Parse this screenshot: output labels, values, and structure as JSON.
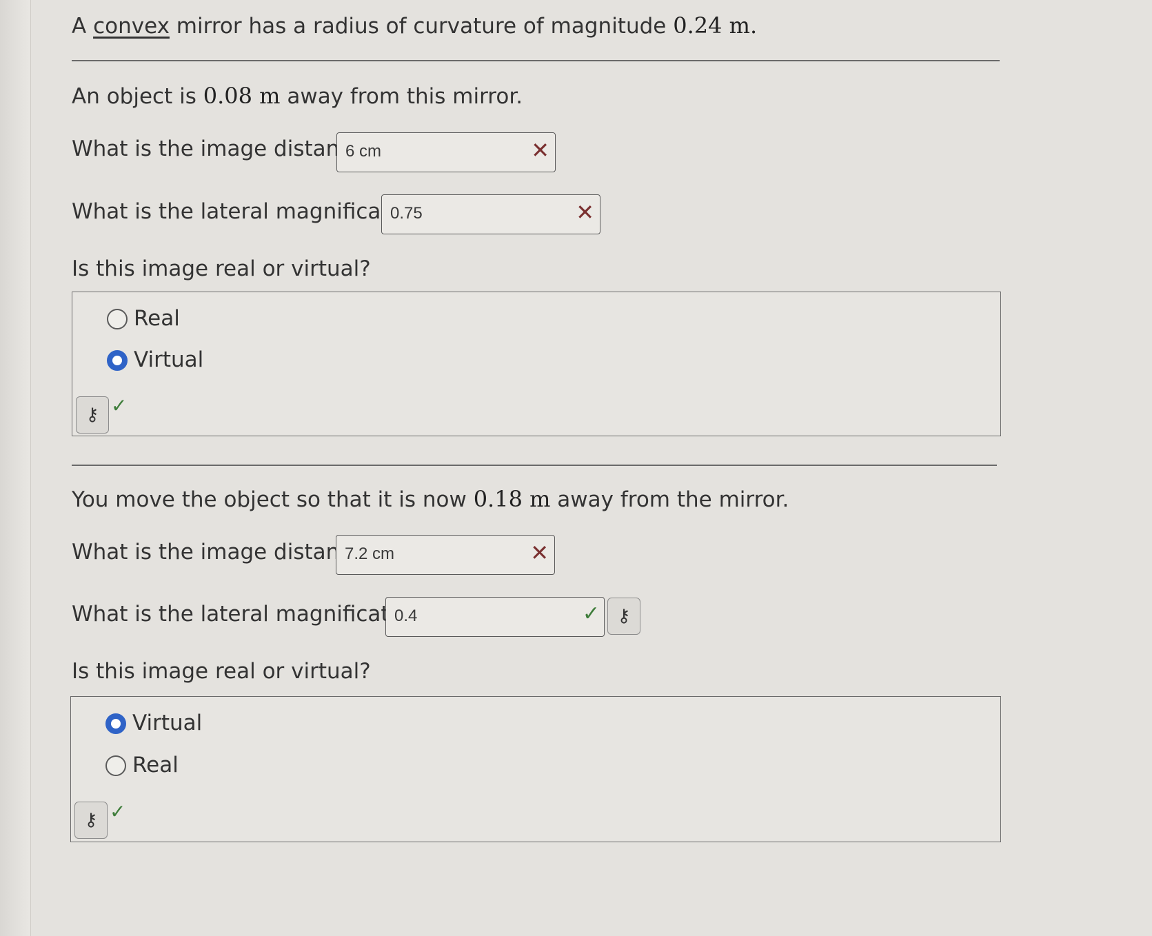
{
  "problem": {
    "intro_prefix": "A ",
    "intro_underlined": "convex",
    "intro_suffix": " mirror has a radius of curvature of magnitude ",
    "intro_value": "0.24 m.",
    "part1": {
      "statement_prefix": "An object is ",
      "statement_value": "0.08 m",
      "statement_suffix": " away from this mirror.",
      "image_distance_q": "What is the image distance?",
      "image_distance_value": "6 cm",
      "image_distance_status": "incorrect",
      "magnification_q": "What is the lateral magnification?",
      "magnification_value": "0.75",
      "magnification_status": "incorrect",
      "real_virtual_q": "Is this image real or virtual?",
      "options": [
        "Real",
        "Virtual"
      ],
      "selected": "Virtual",
      "status": "correct"
    },
    "part2": {
      "statement_prefix": "You move the object so that it is now ",
      "statement_value": "0.18 m",
      "statement_suffix": " away from the mirror.",
      "image_distance_q": "What is the image distance?",
      "image_distance_value": "7.2 cm",
      "image_distance_status": "incorrect",
      "magnification_q": "What is the lateral magnification?",
      "magnification_value": "0.4",
      "magnification_status": "correct",
      "real_virtual_q": "Is this image real or virtual?",
      "options": [
        "Virtual",
        "Real"
      ],
      "selected": "Virtual",
      "status": "correct"
    }
  },
  "icons": {
    "incorrect": "x-icon",
    "correct": "checkmark-icon",
    "key": "key-icon",
    "x_glyph": "✕",
    "check_glyph": "✓",
    "key_glyph": "⚷"
  },
  "colors": {
    "radio_selected": "#2f63c7",
    "incorrect_mark": "#7a3030",
    "correct_mark": "#3e7d3a"
  }
}
